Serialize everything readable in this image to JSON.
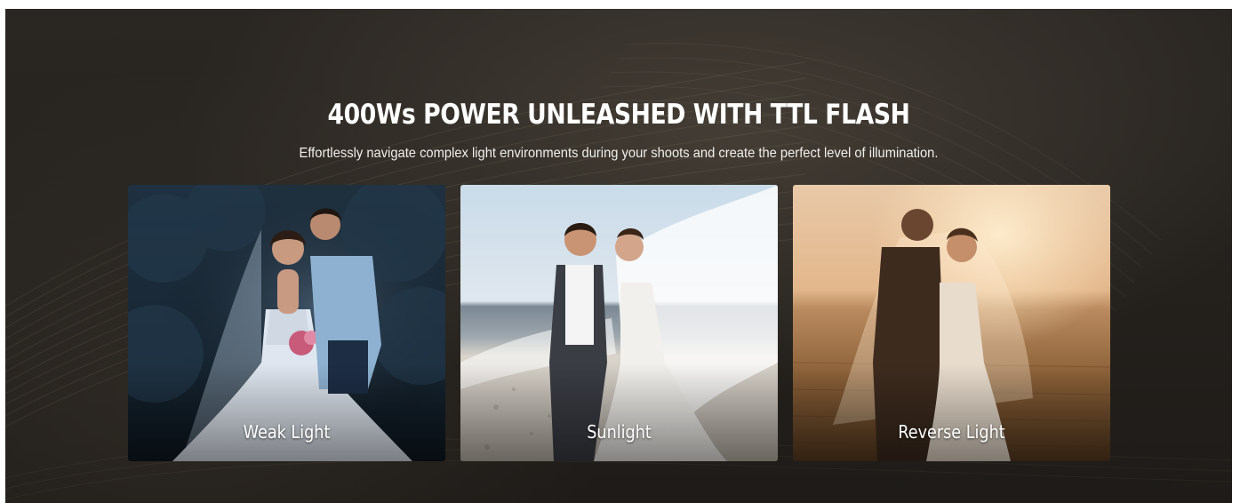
{
  "section": {
    "title": "400Ws POWER UNLEASHED WITH TTL FLASH",
    "subtitle": "Effortlessly navigate complex light environments during your shoots and create the perfect level of illumination."
  },
  "cards": [
    {
      "label": "Weak Light"
    },
    {
      "label": "Sunlight"
    },
    {
      "label": "Reverse Light"
    }
  ]
}
